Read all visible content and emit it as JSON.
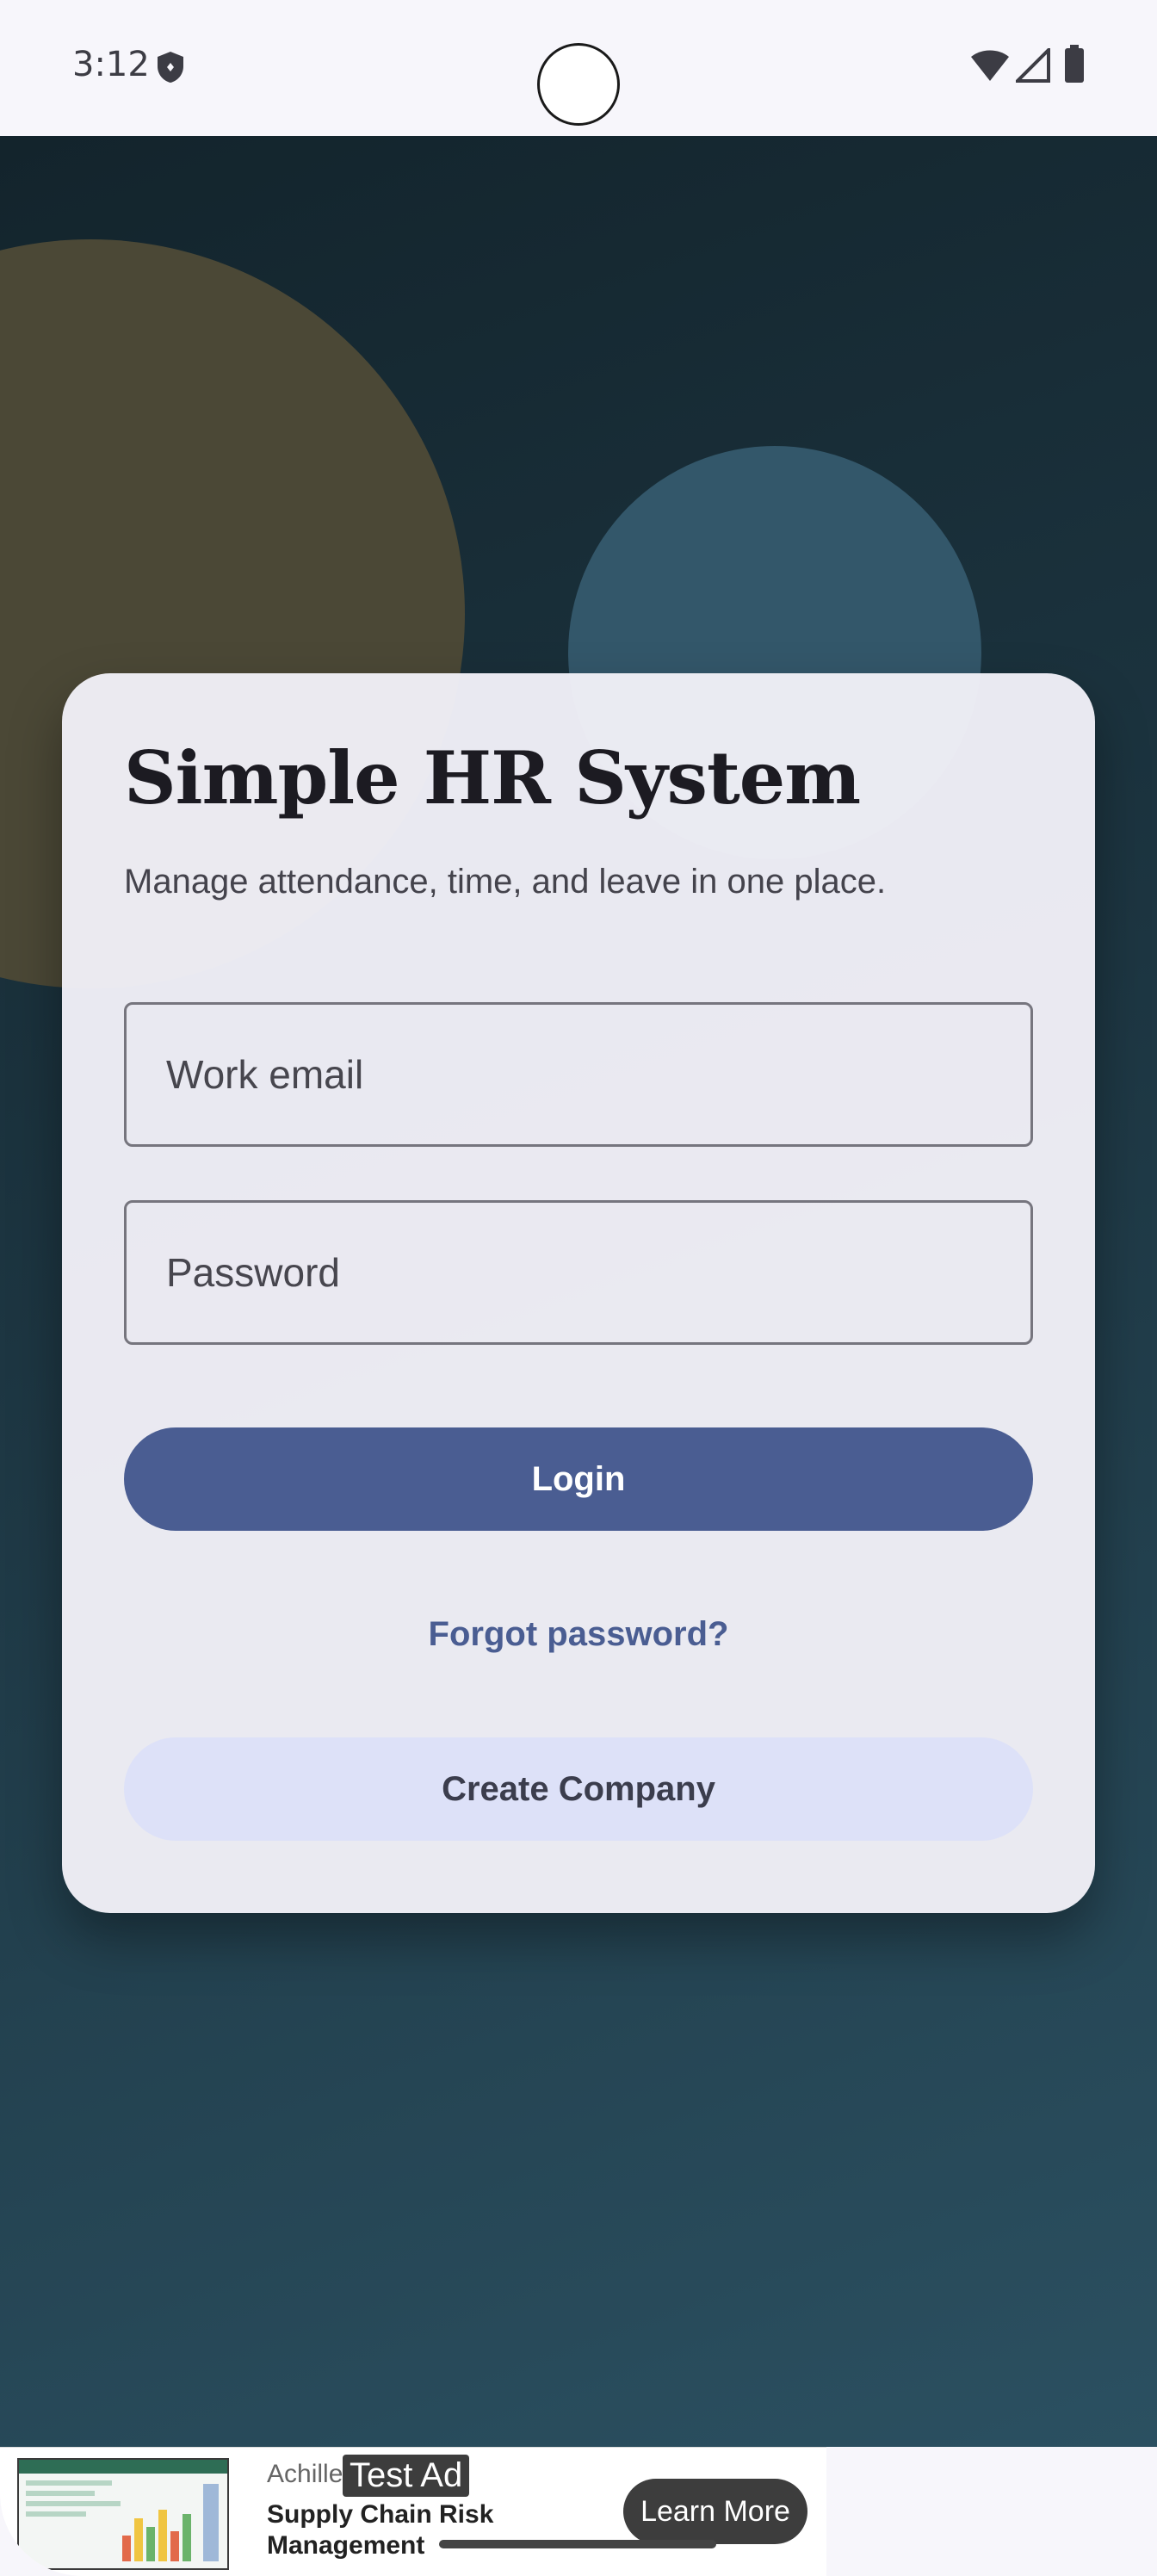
{
  "status_bar": {
    "time": "3:12",
    "icons": [
      "shield-icon",
      "wifi-icon",
      "signal-icon",
      "battery-icon"
    ]
  },
  "card": {
    "title": "Simple HR System",
    "subtitle": "Manage attendance, time, and leave in one place.",
    "email_placeholder": "Work email",
    "password_placeholder": "Password",
    "login_label": "Login",
    "forgot_label": "Forgot password?",
    "create_label": "Create Company"
  },
  "ad": {
    "brand": "Achille",
    "badge": "Test Ad",
    "headline": "Supply Chain Risk Management",
    "cta": "Learn More"
  },
  "colors": {
    "primary": "#4a5d92",
    "secondary_container": "#dde1f8",
    "background_dark": "#13242c",
    "background_light": "#2b5061",
    "blob_gold": "#4b4836",
    "blob_teal": "#33576a"
  }
}
